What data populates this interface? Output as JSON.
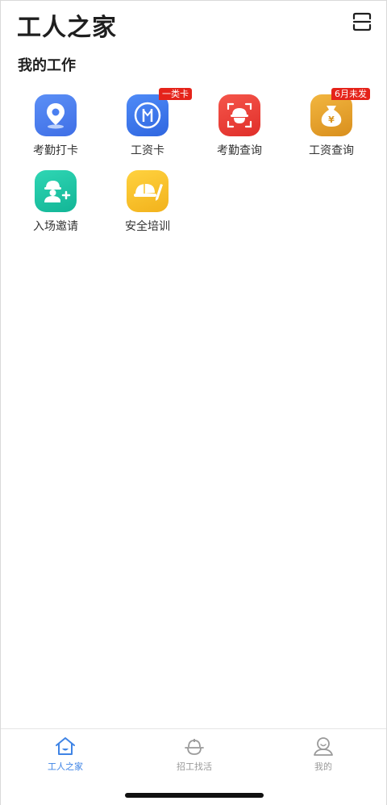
{
  "header": {
    "title": "工人之家",
    "scan_icon": "scan-icon"
  },
  "section": {
    "title": "我的工作"
  },
  "tiles": [
    {
      "label": "考勤打卡",
      "icon": "location-pin-icon",
      "color": "#4a7ff0"
    },
    {
      "label": "工资卡",
      "icon": "salary-card-icon",
      "color": "#3f7cf2",
      "badge": "一类卡"
    },
    {
      "label": "考勤查询",
      "icon": "face-scan-icon",
      "color": "#ef4136"
    },
    {
      "label": "工资查询",
      "icon": "money-bag-icon",
      "color": "#e7a42b",
      "badge": "6月未发"
    },
    {
      "label": "入场邀请",
      "icon": "worker-add-icon",
      "color": "#1fc7a6"
    },
    {
      "label": "安全培训",
      "icon": "helmet-training-icon",
      "color": "#f6c22c"
    }
  ],
  "tabbar": {
    "items": [
      {
        "label": "工人之家",
        "icon": "home-icon",
        "active": true
      },
      {
        "label": "招工找活",
        "icon": "hardhat-icon",
        "active": false
      },
      {
        "label": "我的",
        "icon": "profile-icon",
        "active": false
      }
    ],
    "active_color": "#3f84e5",
    "inactive_color": "#9a9a9a"
  }
}
